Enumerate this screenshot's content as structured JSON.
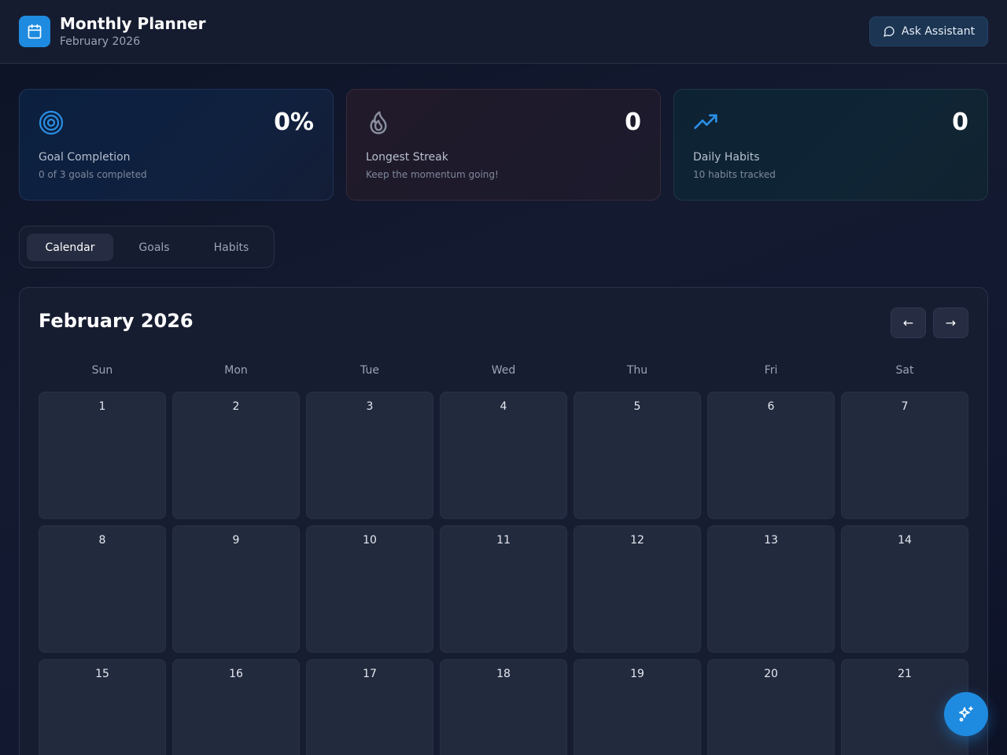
{
  "header": {
    "title": "Monthly Planner",
    "subtitle": "February 2026",
    "ask_label": "Ask Assistant",
    "app_icon": "calendar-icon"
  },
  "stats": [
    {
      "icon": "target-icon",
      "value": "0%",
      "label": "Goal Completion",
      "sub": "0 of 3 goals completed",
      "color": "#2a8fe6"
    },
    {
      "icon": "flame-icon",
      "value": "0",
      "label": "Longest Streak",
      "sub": "Keep the momentum going!",
      "color": "#8a8fa0"
    },
    {
      "icon": "trending-up-icon",
      "value": "0",
      "label": "Daily Habits",
      "sub": "10 habits tracked",
      "color": "#2a8fe6"
    }
  ],
  "tabs": [
    {
      "label": "Calendar",
      "active": true
    },
    {
      "label": "Goals",
      "active": false
    },
    {
      "label": "Habits",
      "active": false
    }
  ],
  "calendar": {
    "title": "February 2026",
    "prev_label": "←",
    "next_label": "→",
    "weekdays": [
      "Sun",
      "Mon",
      "Tue",
      "Wed",
      "Thu",
      "Fri",
      "Sat"
    ],
    "days": [
      "1",
      "2",
      "3",
      "4",
      "5",
      "6",
      "7",
      "8",
      "9",
      "10",
      "11",
      "12",
      "13",
      "14",
      "15",
      "16",
      "17",
      "18",
      "19",
      "20",
      "21"
    ]
  },
  "fab": {
    "icon": "sparkles-icon"
  },
  "colors": {
    "accent": "#1e8be0",
    "background": "#0d1225"
  }
}
